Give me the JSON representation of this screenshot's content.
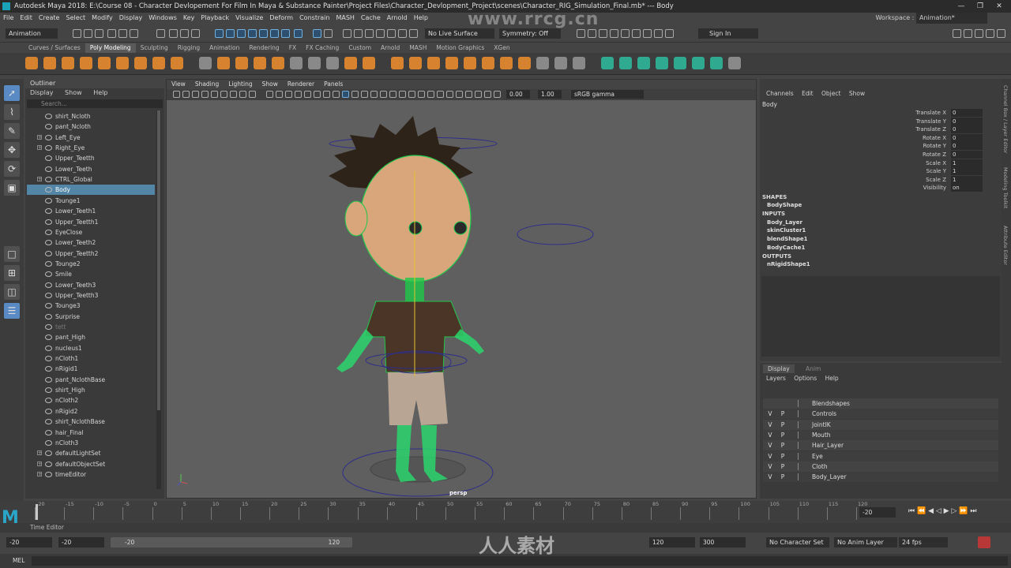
{
  "window": {
    "title": "Autodesk Maya 2018: E:\\Course 08 - Character Devlopement For Film In Maya & Substance Painter\\Project Files\\Character_Devlopment_Project\\scenes\\Character_RIG_Simulation_Final.mb*   ---   Body",
    "min": "—",
    "max": "❐",
    "close": "✕"
  },
  "menubar": [
    "File",
    "Edit",
    "Create",
    "Select",
    "Modify",
    "Display",
    "Windows",
    "Key",
    "Playback",
    "Visualize",
    "Deform",
    "Constrain",
    "MASH",
    "Cache",
    "Arnold",
    "Help"
  ],
  "workspace": {
    "label": "Workspace :",
    "value": "Animation*"
  },
  "statusline": {
    "mode": "Animation",
    "live_surface": "No Live Surface",
    "symmetry": "Symmetry: Off",
    "sign_in": "Sign In"
  },
  "shelf_tabs": [
    "Curves / Surfaces",
    "Poly Modeling",
    "Sculpting",
    "Rigging",
    "Animation",
    "Rendering",
    "FX",
    "FX Caching",
    "Custom",
    "Arnold",
    "MASH",
    "Motion Graphics",
    "XGen"
  ],
  "shelf_active": "Poly Modeling",
  "outliner": {
    "title": "Outliner",
    "menu": [
      "Display",
      "Show",
      "Help"
    ],
    "search_placeholder": "Search...",
    "items": [
      {
        "label": "shirt_Ncloth",
        "exp": false
      },
      {
        "label": "pant_Ncloth",
        "exp": false
      },
      {
        "label": "Left_Eye",
        "exp": true
      },
      {
        "label": "Right_Eye",
        "exp": true
      },
      {
        "label": "Upper_Teetth",
        "exp": false
      },
      {
        "label": "Lower_Teeth",
        "exp": false
      },
      {
        "label": "CTRL_Global",
        "exp": true
      },
      {
        "label": "Body",
        "exp": false,
        "selected": true
      },
      {
        "label": "Tounge1",
        "exp": false
      },
      {
        "label": "Lower_Teeth1",
        "exp": false
      },
      {
        "label": "Upper_Teetth1",
        "exp": false
      },
      {
        "label": "EyeClose",
        "exp": false
      },
      {
        "label": "Lower_Teeth2",
        "exp": false
      },
      {
        "label": "Upper_Teetth2",
        "exp": false
      },
      {
        "label": "Tounge2",
        "exp": false
      },
      {
        "label": "Smile",
        "exp": false
      },
      {
        "label": "Lower_Teeth3",
        "exp": false
      },
      {
        "label": "Upper_Teetth3",
        "exp": false
      },
      {
        "label": "Tounge3",
        "exp": false
      },
      {
        "label": "Surprise",
        "exp": false
      },
      {
        "label": "tett",
        "exp": false,
        "grey": true
      },
      {
        "label": "pant_High",
        "exp": false
      },
      {
        "label": "nucleus1",
        "exp": false
      },
      {
        "label": "nCloth1",
        "exp": false
      },
      {
        "label": "nRigid1",
        "exp": false
      },
      {
        "label": "pant_NclothBase",
        "exp": false
      },
      {
        "label": "shirt_High",
        "exp": false
      },
      {
        "label": "nCloth2",
        "exp": false
      },
      {
        "label": "nRigid2",
        "exp": false
      },
      {
        "label": "shirt_NclothBase",
        "exp": false
      },
      {
        "label": "hair_Final",
        "exp": false
      },
      {
        "label": "nCloth3",
        "exp": false
      },
      {
        "label": "defaultLightSet",
        "exp": true
      },
      {
        "label": "defaultObjectSet",
        "exp": true
      },
      {
        "label": "timeEditor",
        "exp": true
      }
    ]
  },
  "viewport": {
    "menu": [
      "View",
      "Shading",
      "Lighting",
      "Show",
      "Renderer",
      "Panels"
    ],
    "exposure": "0.00",
    "gamma": "1.00",
    "colorspace": "sRGB gamma",
    "camera": "persp"
  },
  "channelbox": {
    "menu": [
      "Channels",
      "Edit",
      "Object",
      "Show"
    ],
    "object": "Body",
    "channels": [
      {
        "label": "Translate X",
        "value": "0"
      },
      {
        "label": "Translate Y",
        "value": "0"
      },
      {
        "label": "Translate Z",
        "value": "0"
      },
      {
        "label": "Rotate X",
        "value": "0"
      },
      {
        "label": "Rotate Y",
        "value": "0"
      },
      {
        "label": "Rotate Z",
        "value": "0"
      },
      {
        "label": "Scale X",
        "value": "1"
      },
      {
        "label": "Scale Y",
        "value": "1"
      },
      {
        "label": "Scale Z",
        "value": "1"
      },
      {
        "label": "Visibility",
        "value": "on"
      }
    ],
    "shapes_header": "SHAPES",
    "shapes": [
      "BodyShape"
    ],
    "inputs_header": "INPUTS",
    "inputs": [
      "Body_Layer",
      "skinCluster1",
      "blendShape1",
      "BodyCache1"
    ],
    "outputs_header": "OUTPUTS",
    "outputs": [
      "nRigidShape1"
    ]
  },
  "side_tabs": [
    "Channel Box / Layer Editor",
    "Modeling Toolkit",
    "Attribute Editor"
  ],
  "layer_editor": {
    "tabs": [
      "Display",
      "Anim"
    ],
    "menu": [
      "Layers",
      "Options",
      "Help"
    ],
    "layers": [
      {
        "v": "",
        "p": "",
        "name": "Blendshapes"
      },
      {
        "v": "V",
        "p": "P",
        "name": "Controls"
      },
      {
        "v": "V",
        "p": "P",
        "name": "JointIK"
      },
      {
        "v": "V",
        "p": "P",
        "name": "Mouth"
      },
      {
        "v": "V",
        "p": "P",
        "name": "Hair_Layer"
      },
      {
        "v": "V",
        "p": "P",
        "name": "Eye"
      },
      {
        "v": "V",
        "p": "P",
        "name": "Cloth"
      },
      {
        "v": "V",
        "p": "P",
        "name": "Body_Layer"
      }
    ]
  },
  "timeline": {
    "ticks": [
      "-20",
      "-15",
      "-10",
      "-5",
      "0",
      "5",
      "10",
      "15",
      "20",
      "25",
      "30",
      "35",
      "40",
      "45",
      "50",
      "55",
      "60",
      "65",
      "70",
      "75",
      "80",
      "85",
      "90",
      "95",
      "100",
      "105",
      "110",
      "115",
      "120"
    ],
    "current_frame": "-20"
  },
  "time_editor_label": "Time Editor",
  "range": {
    "start": "-20",
    "playback_start": "-20",
    "slider_start": "-20",
    "slider_end": "120",
    "playback_end": "120",
    "end": "300",
    "character_set": "No Character Set",
    "anim_layer": "No Anim Layer",
    "fps": "24 fps"
  },
  "cmdline_label": "MEL",
  "watermarks": [
    "www.rrcg.cn",
    "人人素材"
  ]
}
